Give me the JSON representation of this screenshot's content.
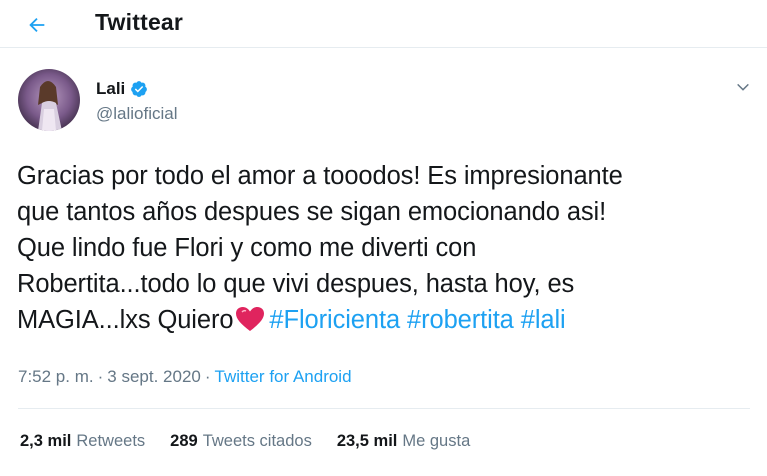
{
  "header": {
    "title": "Twittear",
    "back_icon": "arrow-left-icon"
  },
  "author": {
    "name": "Lali",
    "handle": "@lalioficial",
    "verified_icon": "verified-badge-icon",
    "menu_icon": "chevron-down-icon"
  },
  "tweet": {
    "line1": "Gracias por todo el amor a tooodos! Es impresionante",
    "line2": "que tantos años despues se sigan emocionando asi!",
    "line3": "Que lindo fue Flori y como me diverti con",
    "line4": "Robertita...todo lo que vivi despues, hasta hoy, es",
    "line5_text": "MAGIA...lxs Quiero",
    "emoji_icon": "sparkling-heart-icon",
    "hashtags": [
      "#Floricienta",
      "#robertita",
      "#lali"
    ]
  },
  "meta": {
    "time": "7:52 p. m.",
    "separator": "·",
    "date": "3 sept. 2020",
    "source": "Twitter for Android"
  },
  "stats": {
    "retweets_count": "2,3 mil",
    "retweets_label": "Retweets",
    "quotes_count": "289",
    "quotes_label": "Tweets citados",
    "likes_count": "23,5 mil",
    "likes_label": "Me gusta"
  },
  "colors": {
    "accent": "#1da1f2",
    "muted": "#657786",
    "text": "#14171a"
  }
}
